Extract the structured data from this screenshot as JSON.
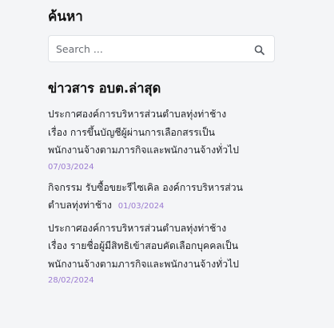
{
  "search_widget": {
    "title": "ค้นหา",
    "placeholder": "Search ..."
  },
  "news_widget": {
    "title": "ข่าวสาร อบต.ล่าสุด",
    "items": [
      {
        "lines": [
          "ประกาศองค์การบริหารส่วนตำบลทุ่งท่าช้าง",
          "เรื่อง การขึ้นบัญชีผู้ผ่านการเลือกสรรเป็น",
          "พนักงานจ้างตามภารกิจและพนักงานจ้างทั่วไป"
        ],
        "date": "07/03/2024"
      },
      {
        "lines": [
          "กิจกรรม รับซื้อขยะรีไซเคิล องค์การบริหารส่วน",
          "ตำบลทุ่งท่าช้าง"
        ],
        "date": "01/03/2024"
      },
      {
        "lines": [
          "ประกาศองค์การบริหารส่วนตำบลทุ่งท่าช้าง",
          "เรื่อง รายชื่อผู้มีสิทธิเข้าสอบคัดเลือกบุคคลเป็น",
          "พนักงานจ้างตามภารกิจและพนักงานจ้างทั่วไป"
        ],
        "date": "28/02/2024"
      }
    ]
  },
  "colors": {
    "background": "#f4f5f7",
    "date_accent": "#9b7bd1",
    "search_icon": "#555a62"
  },
  "icons": {
    "search": "search-icon"
  }
}
